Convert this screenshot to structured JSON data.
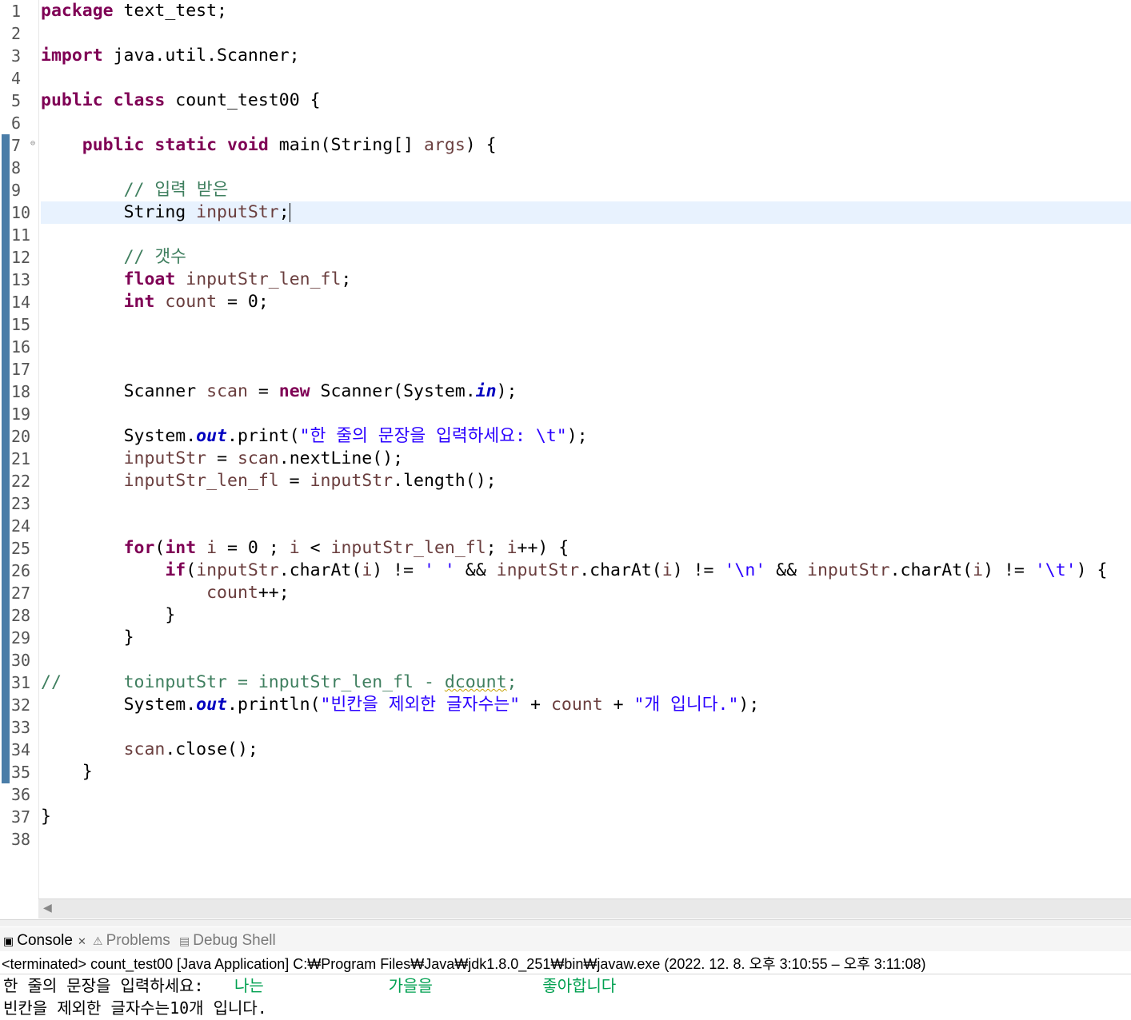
{
  "editor": {
    "line_numbers": [
      "1",
      "2",
      "3",
      "4",
      "5",
      "6",
      "7",
      "8",
      "9",
      "10",
      "11",
      "12",
      "13",
      "14",
      "15",
      "16",
      "17",
      "18",
      "19",
      "20",
      "21",
      "22",
      "23",
      "24",
      "25",
      "26",
      "27",
      "28",
      "29",
      "30",
      "31",
      "32",
      "33",
      "34",
      "35",
      "36",
      "37",
      "38"
    ],
    "fold_marker": "⊖",
    "tokens": {
      "l1_kw": "package",
      "l1_rest": " text_test;",
      "l3_kw": "import",
      "l3_rest": " java.util.Scanner;",
      "l5_kw1": "public",
      "l5_kw2": "class",
      "l5_rest": " count_test00 {",
      "l7_kw1": "public",
      "l7_kw2": "static",
      "l7_kw3": "void",
      "l7_a": " main(String[] ",
      "l7_var": "args",
      "l7_b": ") {",
      "l9_cm": "// 입력 받은",
      "l10_a": "String ",
      "l10_var": "inputStr",
      "l10_b": ";",
      "l12_cm": "// 갯수",
      "l13_kw": "float",
      "l13_var": "inputStr_len_fl",
      "l13_b": ";",
      "l14_kw": "int",
      "l14_var": "count",
      "l14_b": " = 0;",
      "l18_a": "Scanner ",
      "l18_var": "scan",
      "l18_b": " = ",
      "l18_kw": "new",
      "l18_c": " Scanner(System.",
      "l18_stat": "in",
      "l18_d": ");",
      "l20_a": "System.",
      "l20_stat": "out",
      "l20_b": ".print(",
      "l20_str": "\"한 줄의 문장을 입력하세요: \\t\"",
      "l20_c": ");",
      "l21_var1": "inputStr",
      "l21_a": " = ",
      "l21_var2": "scan",
      "l21_b": ".nextLine();",
      "l22_var1": "inputStr_len_fl",
      "l22_a": " = ",
      "l22_var2": "inputStr",
      "l22_b": ".length();",
      "l25_kw1": "for",
      "l25_a": "(",
      "l25_kw2": "int",
      "l25_var1": " i",
      "l25_b": " = 0 ; ",
      "l25_var2": "i",
      "l25_c": " < ",
      "l25_var3": "inputStr_len_fl",
      "l25_d": "; ",
      "l25_var4": "i",
      "l25_e": "++) {",
      "l26_kw": "if",
      "l26_a": "(",
      "l26_v1": "inputStr",
      "l26_b": ".charAt(",
      "l26_v2": "i",
      "l26_c": ") != ",
      "l26_s1": "' '",
      "l26_d": " && ",
      "l26_v3": "inputStr",
      "l26_e": ".charAt(",
      "l26_v4": "i",
      "l26_f": ") != ",
      "l26_s2": "'\\n'",
      "l26_g": " && ",
      "l26_v5": "inputStr",
      "l26_h": ".charAt(",
      "l26_v6": "i",
      "l26_i": ") != ",
      "l26_s3": "'\\t'",
      "l26_j": ") {",
      "l27_var": "count",
      "l27_b": "++;",
      "l28": "}",
      "l29": "}",
      "l31_cm1": "//",
      "l31_cm2": "toinputStr = inputStr_len_fl - ",
      "l31_cm3": "dcount",
      "l31_cm4": ";",
      "l32_a": "System.",
      "l32_stat": "out",
      "l32_b": ".println(",
      "l32_s1": "\"빈칸을 제외한 글자수는\"",
      "l32_c": " + ",
      "l32_var": "count",
      "l32_d": " + ",
      "l32_s2": "\"개 입니다.\"",
      "l32_e": ");",
      "l34_var": "scan",
      "l34_b": ".close();",
      "l35": "}",
      "l37": "}"
    }
  },
  "console": {
    "tabs": [
      {
        "label": "Console",
        "icon": "console-icon"
      },
      {
        "label": "Problems",
        "icon": "problems-icon"
      },
      {
        "label": "Debug Shell",
        "icon": "debug-shell-icon"
      }
    ],
    "status": "<terminated> count_test00 [Java Application] C:₩Program Files₩Java₩jdk1.8.0_251₩bin₩javaw.exe  (2022. 12. 8. 오후 3:10:55 – 오후 3:11:08)",
    "prompt": "한 줄의 문장을 입력하세요: ",
    "user_input": "\t나는\t\t가을을\t\t좋아합니다",
    "result": "빈칸을 제외한 글자수는10개 입니다."
  }
}
